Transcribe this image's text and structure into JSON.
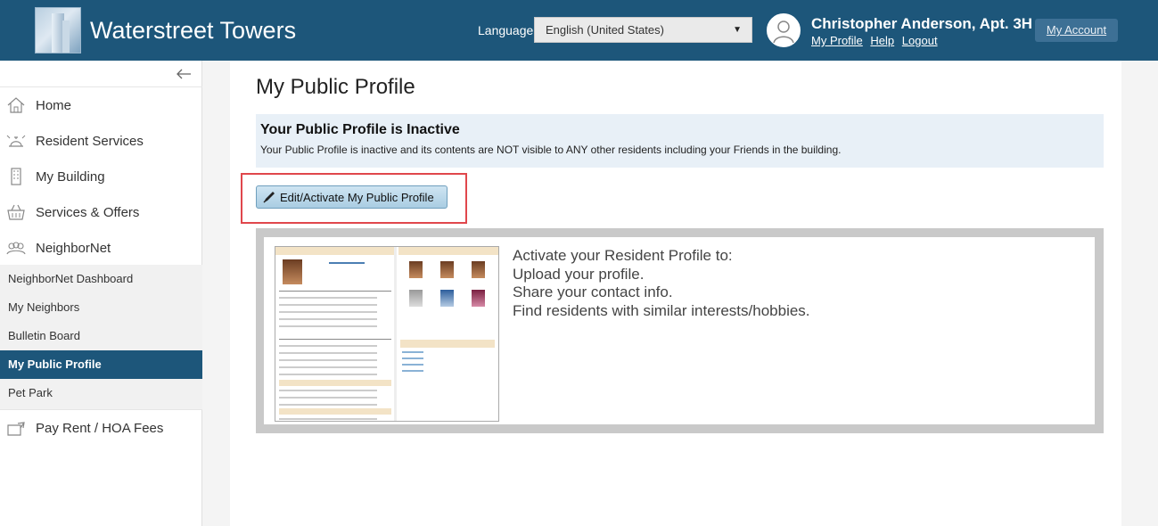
{
  "header": {
    "app_title": "Waterstreet Towers",
    "language_label": "Language:",
    "language_value": "English (United States)",
    "user_name": "Christopher Anderson, Apt. 3H",
    "links": [
      "My Profile",
      "Help",
      "Logout"
    ],
    "account_button": "My Account"
  },
  "sidebar": {
    "items": [
      {
        "label": "Home",
        "icon": "home-icon"
      },
      {
        "label": "Resident Services",
        "icon": "service-bell-icon"
      },
      {
        "label": "My Building",
        "icon": "building-icon"
      },
      {
        "label": "Services & Offers",
        "icon": "basket-icon"
      },
      {
        "label": "NeighborNet",
        "icon": "people-icon"
      }
    ],
    "sub_items": [
      "NeighborNet Dashboard",
      "My Neighbors",
      "Bulletin Board",
      "My Public Profile",
      "Pet Park"
    ],
    "active_sub": "My Public Profile",
    "bottom_item": {
      "label": "Pay Rent / HOA Fees",
      "icon": "payment-icon"
    }
  },
  "main": {
    "page_title": "My Public Profile",
    "status_title": "Your Public Profile is Inactive",
    "status_desc": "Your Public Profile is inactive and its contents are NOT visible to ANY other residents including your Friends in the building.",
    "edit_button": "Edit/Activate My Public Profile",
    "promo_lines": [
      "Activate your Resident Profile to:",
      "Upload your profile.",
      "Share your contact info.",
      "Find residents with similar interests/hobbies."
    ]
  },
  "colors": {
    "header_bg": "#1d567a",
    "active_nav": "#1d567a",
    "highlight_border": "#e0474c"
  }
}
